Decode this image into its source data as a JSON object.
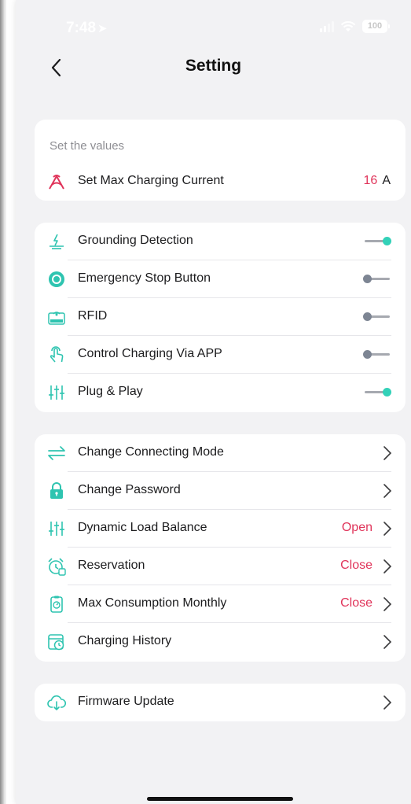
{
  "status_bar": {
    "time": "7:48",
    "location_glyph": "➤",
    "battery": "100"
  },
  "nav": {
    "title": "Setting",
    "back_icon": "chevron-left-icon"
  },
  "values_section": {
    "label": "Set the values",
    "max_current": {
      "label": "Set Max Charging Current",
      "value": "16",
      "unit": "A"
    }
  },
  "toggles": [
    {
      "label": "Grounding Detection",
      "on": true
    },
    {
      "label": "Emergency Stop Button",
      "on": false
    },
    {
      "label": "RFID",
      "on": false
    },
    {
      "label": "Control Charging Via APP",
      "on": false
    },
    {
      "label": "Plug & Play",
      "on": true
    }
  ],
  "menu": [
    {
      "label": "Change Connecting Mode",
      "value": ""
    },
    {
      "label": "Change Password",
      "value": ""
    },
    {
      "label": "Dynamic Load Balance",
      "value": "Open"
    },
    {
      "label": "Reservation",
      "value": "Close"
    },
    {
      "label": "Max Consumption Monthly",
      "value": "Close"
    },
    {
      "label": "Charging History",
      "value": ""
    }
  ],
  "firmware": {
    "label": "Firmware Update"
  },
  "colors": {
    "accent_red": "#e0345a",
    "toggle_on": "#33d1b8",
    "icon_teal": "#2ec4b0",
    "background": "#f2f2f4"
  },
  "icons": {
    "max_current": "charging-current-icon",
    "toggles": [
      "grounding-icon",
      "emergency-stop-icon",
      "rfid-icon",
      "touch-app-icon",
      "sliders-icon"
    ],
    "menu": [
      "arrows-swap-icon",
      "lock-icon",
      "sliders-icon",
      "alarm-clock-icon",
      "meter-icon",
      "history-icon"
    ],
    "firmware": "cloud-download-icon"
  }
}
